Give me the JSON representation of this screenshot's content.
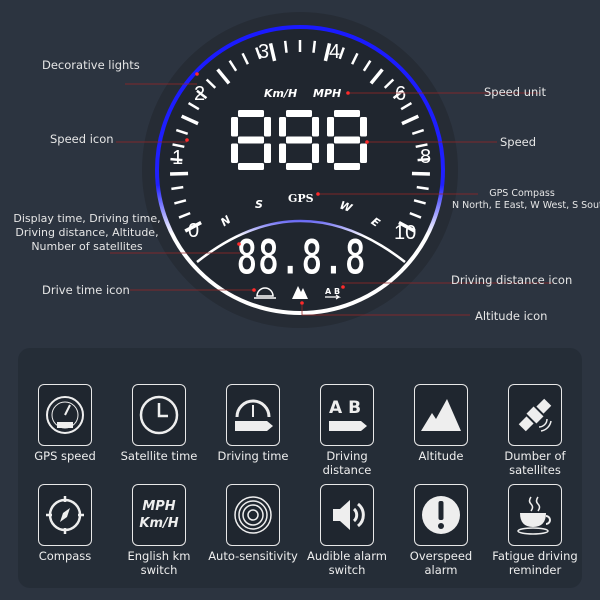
{
  "gauge": {
    "scale_labels": [
      "0",
      "1",
      "2",
      "3",
      "4",
      "6",
      "8",
      "10"
    ],
    "units": [
      "Km/H",
      "MPH"
    ],
    "speed_digits": "888",
    "info_digits": "88.8.8",
    "gps_label": "GPS",
    "compass_letters": [
      "N",
      "S",
      "W",
      "E"
    ],
    "colors": {
      "decorative_light": "#1a1aff",
      "ring": "#ffffff",
      "annotation_line": "#a02828"
    }
  },
  "annotations": {
    "decorative_lights": "Decorative lights",
    "speed_unit": "Speed unit",
    "speed_icon": "Speed icon",
    "speed": "Speed",
    "gps_compass_title": "GPS Compass",
    "gps_compass_desc": "N North, E East, W West, S South",
    "display_line1": "Display time, Driving time,",
    "display_line2": "Driving distance, Altitude,",
    "display_line3": "Number of satellites",
    "drive_time_icon": "Drive time icon",
    "driving_distance_icon": "Driving distance icon",
    "altitude_icon": "Altitude icon"
  },
  "features": [
    {
      "label": "GPS speed",
      "icon": "speedometer-icon"
    },
    {
      "label": "Satellite time",
      "icon": "clock-icon"
    },
    {
      "label": "Driving time",
      "icon": "drive-time-icon"
    },
    {
      "label": "Driving distance",
      "icon": "ab-distance-icon",
      "text": "A B"
    },
    {
      "label": "Altitude",
      "icon": "mountain-icon"
    },
    {
      "label": "Dumber of satellites",
      "icon": "satellite-icon"
    },
    {
      "label": "Compass",
      "icon": "compass-icon"
    },
    {
      "label": "English km switch",
      "icon": "unit-switch-icon",
      "text1": "MPH",
      "text2": "Km/H"
    },
    {
      "label": "Auto-sensitivity",
      "icon": "sensor-icon"
    },
    {
      "label": "Audible alarm switch",
      "icon": "speaker-icon"
    },
    {
      "label": "Overspeed alarm",
      "icon": "alert-icon"
    },
    {
      "label": "Fatigue driving reminder",
      "icon": "coffee-cup-icon"
    }
  ]
}
